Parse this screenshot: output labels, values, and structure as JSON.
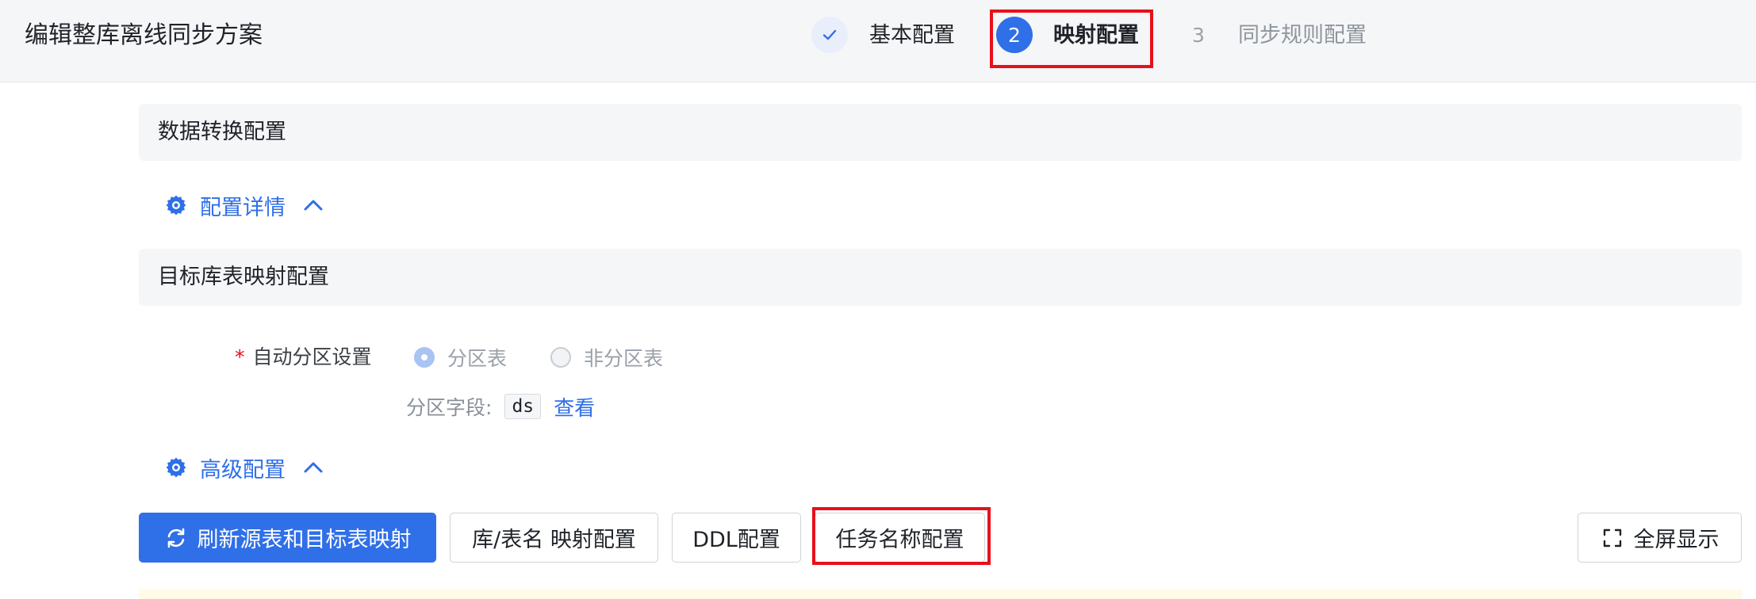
{
  "header": {
    "title": "编辑整库离线同步方案",
    "steps": [
      {
        "number": "✓",
        "label": "基本配置",
        "state": "done"
      },
      {
        "number": "2",
        "label": "映射配置",
        "state": "active"
      },
      {
        "number": "3",
        "label": "同步规则配置",
        "state": "pending"
      }
    ]
  },
  "sections": {
    "data_transform": {
      "title": "数据转换配置"
    },
    "config_detail": {
      "label": "配置详情"
    },
    "target_mapping": {
      "title": "目标库表映射配置"
    },
    "advanced": {
      "label": "高级配置"
    }
  },
  "form": {
    "required_mark": "*",
    "auto_partition_label": "自动分区设置",
    "options": [
      {
        "label": "分区表",
        "checked": true
      },
      {
        "label": "非分区表",
        "checked": false
      }
    ],
    "partition_field_label": "分区字段:",
    "partition_field_value": "ds",
    "view_link": "查看"
  },
  "toolbar": {
    "refresh": "刷新源表和目标表映射",
    "db_table_mapping": "库/表名 映射配置",
    "ddl": "DDL配置",
    "task_name": "任务名称配置",
    "fullscreen": "全屏显示"
  },
  "colors": {
    "accent": "#2f6fe8",
    "highlight": "#e8101a",
    "header_bg": "#f5f6f7"
  },
  "icons": {
    "step_done": "checkmark-icon",
    "settings": "gear-icon",
    "collapse": "chevron-up-icon",
    "refresh": "refresh-icon",
    "fullscreen": "fullscreen-icon"
  }
}
